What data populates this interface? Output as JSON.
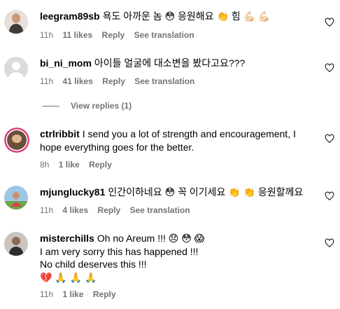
{
  "comments": [
    {
      "username": "leegram89sb",
      "text": "욕도 아까운 놈 😳 응원해요 👏 힘 💪🏻 💪🏻",
      "time": "11h",
      "likes": "11 likes",
      "reply": "Reply",
      "translation": "See translation"
    },
    {
      "username": "bi_ni_mom",
      "text": "아이들 얼굴에 대소변을 봤다고요???",
      "time": "11h",
      "likes": "41 likes",
      "reply": "Reply",
      "translation": "See translation",
      "view_replies": "View replies (1)"
    },
    {
      "username": "ctrlribbit",
      "text": "I send you a lot of strength and encouragement, I hope everything goes for the better.",
      "time": "8h",
      "likes": "1 like",
      "reply": "Reply"
    },
    {
      "username": "mjunglucky81",
      "text": "인간이하네요 😳 꼭 이기세요 👏 👏 응원할께요",
      "time": "11h",
      "likes": "4 likes",
      "reply": "Reply",
      "translation": "See translation"
    },
    {
      "username": "misterchills",
      "text_line1": "Oh no Areum !!! 😞 😳 😱",
      "text_line2": "I am very sorry this has happened !!!",
      "text_line3": "No child deserves this !!!",
      "text_line4": "💔 🙏 🙏 🙏",
      "time": "11h",
      "likes": "1 like",
      "reply": "Reply"
    }
  ],
  "colors": {
    "meta": "#737373",
    "text": "#000000",
    "background": "#ffffff"
  },
  "icons": {
    "like": "heart-outline-icon"
  }
}
